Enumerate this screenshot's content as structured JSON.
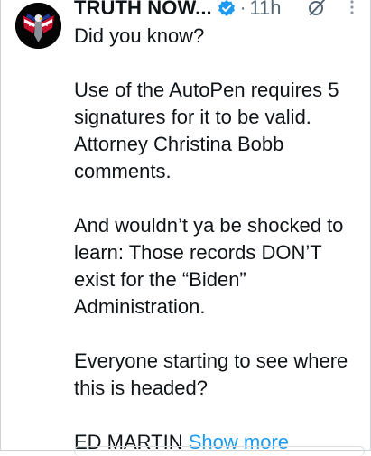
{
  "post": {
    "author": "TRUTH NOW...",
    "separator": "·",
    "time": "11h",
    "paragraphs": [
      "Did you know?",
      "Use of the AutoPen requires 5\nsignatures for it to be valid.\nAttorney Christina Bobb\ncomments.",
      "And wouldn’t ya be shocked to\nlearn: Those records DON’T\nexist for the “Biden”\nAdministration.",
      "Everyone starting to see where\nthis is headed?"
    ],
    "last_line": "ED MARTIN",
    "show_more": "Show more"
  },
  "icons": {
    "avatar": "eagle-flag-avatar",
    "verified": "verified-badge-icon",
    "grok": "grok-icon",
    "more": "more-vertical-icon"
  },
  "colors": {
    "text": "#0f1419",
    "muted": "#536471",
    "link": "#1d9bf0",
    "verified": "#1d9bf0"
  }
}
